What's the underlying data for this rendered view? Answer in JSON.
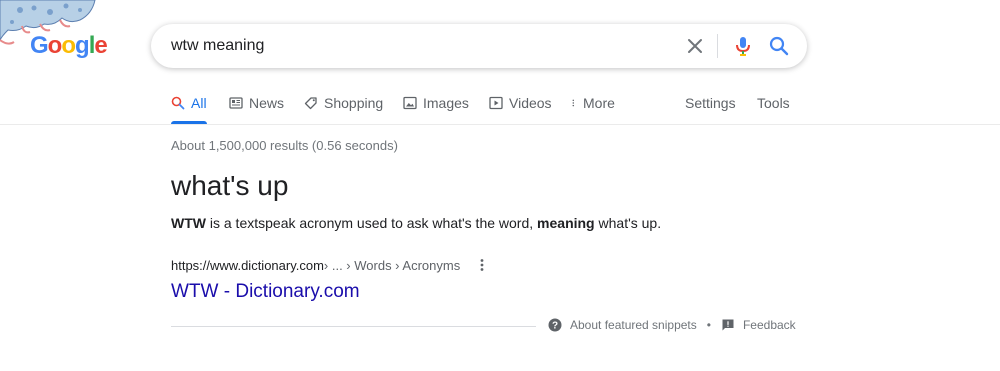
{
  "logo": {
    "letters": [
      "G",
      "o",
      "o",
      "g",
      "l",
      "e"
    ],
    "colors": [
      "#4285f4",
      "#ea4335",
      "#fbbc05",
      "#4285f4",
      "#34a853",
      "#ea4335"
    ]
  },
  "search": {
    "query": "wtw meaning",
    "clear_icon": "close-icon",
    "mic_icon": "mic-icon",
    "search_icon": "search-icon"
  },
  "tabs": [
    {
      "label": "All",
      "icon": "search-icon",
      "active": true
    },
    {
      "label": "News",
      "icon": "news-icon",
      "active": false
    },
    {
      "label": "Shopping",
      "icon": "tag-icon",
      "active": false
    },
    {
      "label": "Images",
      "icon": "image-icon",
      "active": false
    },
    {
      "label": "Videos",
      "icon": "play-icon",
      "active": false
    },
    {
      "label": "More",
      "icon": "more-vert-icon",
      "active": false
    }
  ],
  "tools": {
    "settings": "Settings",
    "tools": "Tools"
  },
  "results": {
    "stats": "About 1,500,000 results (0.56 seconds)",
    "featured": {
      "title": "what's up",
      "desc_parts": [
        "WTW",
        " is a textspeak acronym used to ask what's the word, ",
        "meaning",
        " what's up."
      ],
      "cite_url": "https://www.dictionary.com",
      "cite_path": " › ... › Words › Acronyms",
      "link_title": "WTW - Dictionary.com"
    },
    "footer": {
      "about": "About featured snippets",
      "separator": "•",
      "feedback": "Feedback"
    }
  },
  "colors": {
    "accent": "#1a73e8",
    "link": "#1a0dab",
    "muted": "#70757a"
  }
}
